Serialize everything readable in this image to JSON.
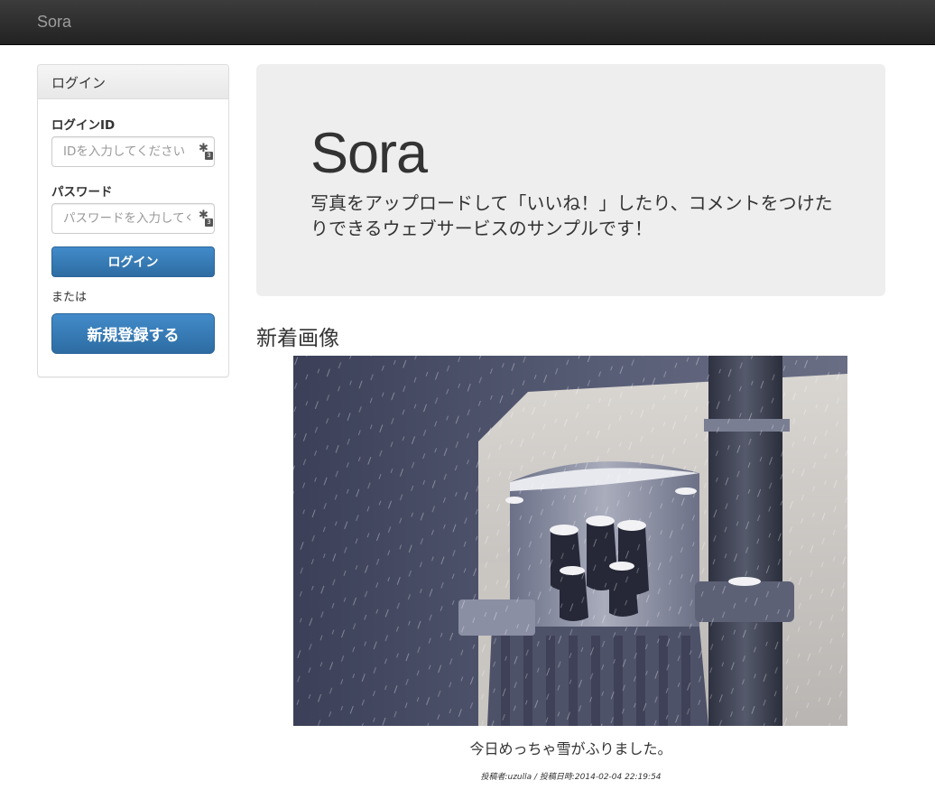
{
  "navbar": {
    "brand": "Sora"
  },
  "login_panel": {
    "heading": "ログイン",
    "login_id_label": "ログインID",
    "login_id_placeholder": "IDを入力してください",
    "password_label": "パスワード",
    "password_placeholder": "パスワードを入力してください",
    "login_button": "ログイン",
    "or_text": "または",
    "register_button": "新規登録する",
    "field_icon_badge": "3",
    "field_icon": "password-manager-key-icon"
  },
  "jumbotron": {
    "title": "Sora",
    "lead": "写真をアップロードして「いいね！」したり、コメントをつけたりできるウェブサービスのサンプルです！"
  },
  "latest": {
    "heading": "新着画像",
    "photo_alt": "snow-covered transformer on utility pole",
    "caption": "今日めっちゃ雪がふりました。",
    "meta": "投稿者:uzulla / 投稿日時:2014-02-04 22:19:54"
  },
  "colors": {
    "navbar_bg": "#222222",
    "brand_text": "#9d9d9d",
    "primary_button": "#428bca",
    "jumbotron_bg": "#eeeeee"
  }
}
